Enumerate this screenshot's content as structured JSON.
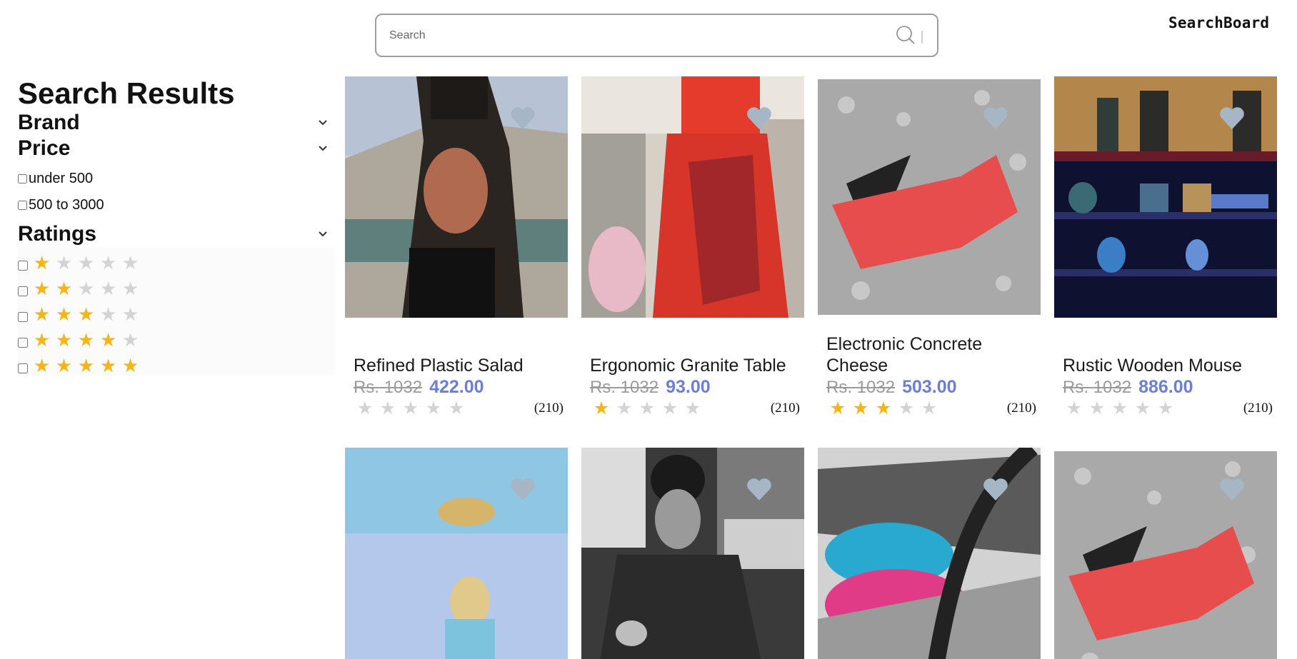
{
  "header": {
    "search_placeholder": "Search",
    "brand": "SearchBoard"
  },
  "sidebar": {
    "title": "Search Results",
    "filters": {
      "brand_label": "Brand",
      "price_label": "Price",
      "price_options": [
        "under 500",
        "500 to 3000"
      ],
      "ratings_label": "Ratings",
      "rating_options": [
        1,
        2,
        3,
        4,
        5
      ]
    }
  },
  "products": [
    {
      "name": "Refined Plastic Salad",
      "old_price": "Rs. 1032",
      "price": "422.00",
      "rating": 0,
      "count": "(210)"
    },
    {
      "name": "Ergonomic Granite Table",
      "old_price": "Rs. 1032",
      "price": "93.00",
      "rating": 1,
      "count": "(210)"
    },
    {
      "name": "Electronic Concrete Cheese",
      "old_price": "Rs. 1032",
      "price": "503.00",
      "rating": 3,
      "count": "(210)"
    },
    {
      "name": "Rustic Wooden Mouse",
      "old_price": "Rs. 1032",
      "price": "886.00",
      "rating": 0,
      "count": "(210)"
    }
  ],
  "colors": {
    "accent_price": "#6b7fd7",
    "star_on": "#f5b516",
    "star_off": "#d3d3d3",
    "heart": "#a6b6c4"
  }
}
